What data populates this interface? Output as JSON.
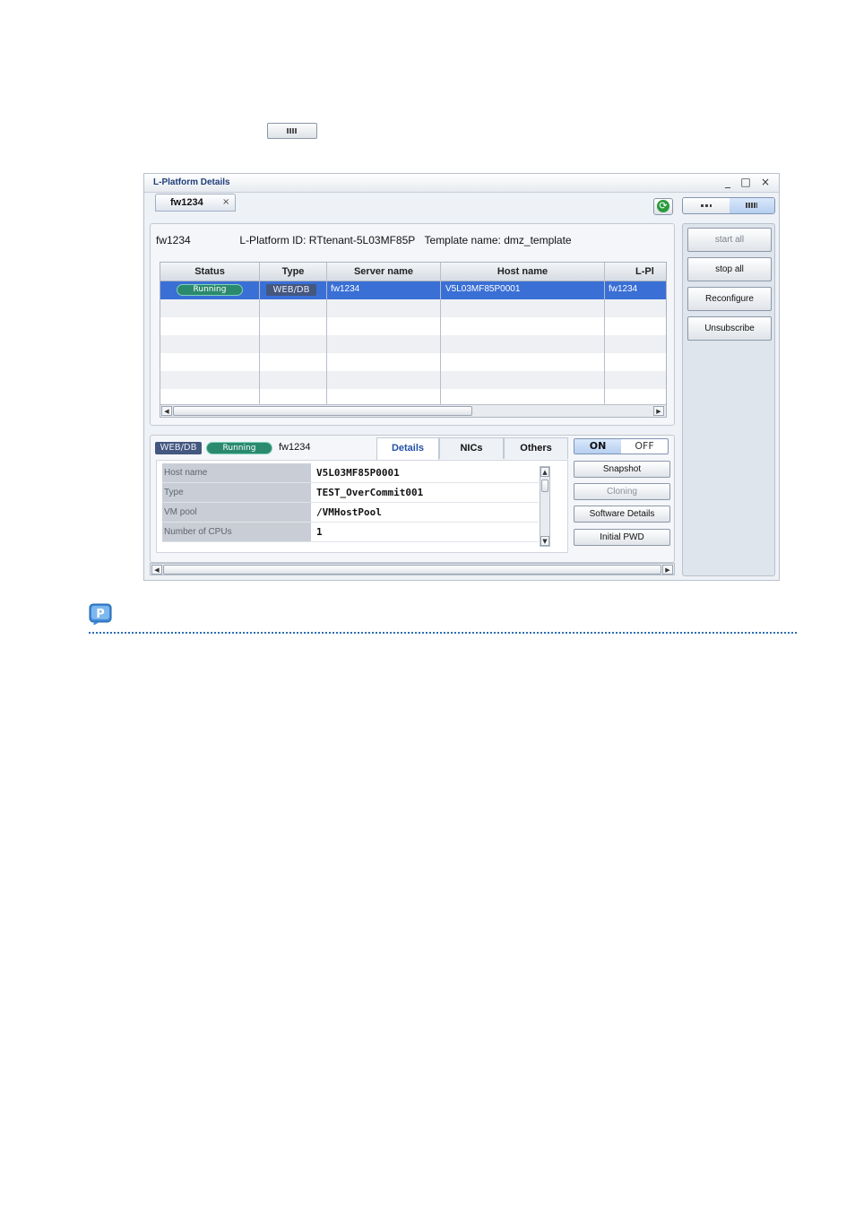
{
  "toolbar_icon": {
    "icon": "list-view-icon"
  },
  "window": {
    "title": "L-Platform Details",
    "controls": {
      "minimize": "_",
      "maximize": "□",
      "close": "×"
    },
    "tab": {
      "label": "fw1234",
      "close": "×"
    },
    "refresh_icon": "refresh-icon",
    "view_toggle": {
      "left_icon": "dots-view-icon",
      "right_icon": "list-view-icon"
    }
  },
  "summary": {
    "name": "fw1234",
    "platform_id_text": "L-Platform ID: RTtenant-5L03MF85P",
    "template_text": "Template name: dmz_template"
  },
  "grid": {
    "headers": [
      "Status",
      "Type",
      "Server name",
      "Host name",
      "L-Pl"
    ],
    "rows": [
      {
        "status": "Running",
        "type": "WEB/DB",
        "server_name": "fw1234",
        "host_name": "V5L03MF85P0001",
        "lplatform": "fw1234"
      }
    ]
  },
  "detail": {
    "type_badge": "WEB/DB",
    "status_badge": "Running",
    "server_name": "fw1234",
    "tabs": [
      "Details",
      "NICs",
      "Others"
    ],
    "fields": [
      {
        "label": "Host name",
        "value": "V5L03MF85P0001"
      },
      {
        "label": "Type",
        "value": "TEST_OverCommit001"
      },
      {
        "label": "VM pool",
        "value": "/VMHostPool"
      },
      {
        "label": "Number of CPUs",
        "value": "1"
      }
    ],
    "power": {
      "on": "ON",
      "off": "OFF"
    },
    "buttons": [
      "Snapshot",
      "Cloning",
      "Software Details",
      "Initial PWD"
    ]
  },
  "side_buttons": [
    "start all",
    "stop all",
    "Reconfigure",
    "Unsubscribe"
  ],
  "point": {
    "icon": "point-icon",
    "letter": "P"
  },
  "colors": {
    "selection": "#3a6fd6",
    "running": "#2b8a6e",
    "type_badge": "#44577f",
    "title": "#1d3d7a"
  }
}
